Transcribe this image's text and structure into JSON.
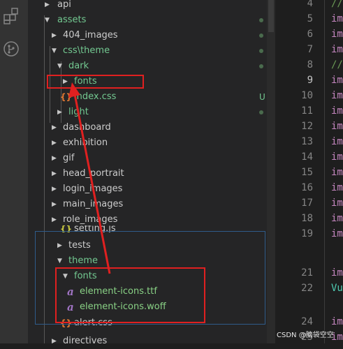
{
  "activity_bar": {
    "icons": [
      "extensions-icon",
      "source-control-icon"
    ]
  },
  "explorer": {
    "tree": [
      {
        "label": "api",
        "status": "",
        "collapsed": true
      },
      {
        "label": "assets",
        "status": "dot",
        "collapsed": false
      },
      {
        "label": "404_images",
        "status": "dot",
        "collapsed": true
      },
      {
        "label": "css\\theme",
        "status": "dot",
        "collapsed": false
      },
      {
        "label": "dark",
        "status": "dot",
        "collapsed": false
      },
      {
        "label": "fonts",
        "status": "",
        "collapsed": true
      },
      {
        "label": "index.css",
        "status": "U",
        "icon_glyph": "{}"
      },
      {
        "label": "light",
        "status": "dot",
        "collapsed": true
      },
      {
        "label": "dashboard",
        "collapsed": true
      },
      {
        "label": "exhibition",
        "collapsed": true
      },
      {
        "label": "gif",
        "collapsed": true
      },
      {
        "label": "head_portrait",
        "collapsed": true
      },
      {
        "label": "login_images",
        "collapsed": true
      },
      {
        "label": "main_images",
        "collapsed": true
      },
      {
        "label": "role_images",
        "collapsed": true
      },
      {
        "label": "setting.js",
        "icon_glyph": "{}"
      },
      {
        "label": "tests",
        "collapsed": true
      },
      {
        "label": "theme",
        "collapsed": false
      },
      {
        "label": "fonts",
        "collapsed": false
      },
      {
        "label": "element-icons.ttf",
        "icon_glyph": "a"
      },
      {
        "label": "element-icons.woff",
        "icon_glyph": "a"
      },
      {
        "label": "alert.css",
        "icon_glyph": "{}"
      },
      {
        "label": "directives",
        "collapsed": true
      }
    ]
  },
  "editor": {
    "line_numbers": [
      "4",
      "5",
      "6",
      "7",
      "8",
      "9",
      "10",
      "11",
      "12",
      "13",
      "14",
      "15",
      "16",
      "17",
      "18",
      "19",
      "",
      "21",
      "22",
      "",
      "24",
      "25"
    ],
    "active_line": "9",
    "code_fragments": [
      "//",
      "im",
      "im",
      "im",
      "//",
      "im",
      "im",
      "im",
      "im",
      "im",
      "im",
      "im",
      "im",
      "im",
      "im",
      "im",
      "",
      "im",
      "Vu",
      "",
      "im",
      "im"
    ]
  },
  "watermark": "CSDN @脑袋空空",
  "colors": {
    "annotation_red": "#e02020",
    "highlight_blue": "#2f5c8a",
    "folder_green": "#73c991",
    "file_green": "#89d185",
    "keyword_purple": "#c586c0"
  }
}
